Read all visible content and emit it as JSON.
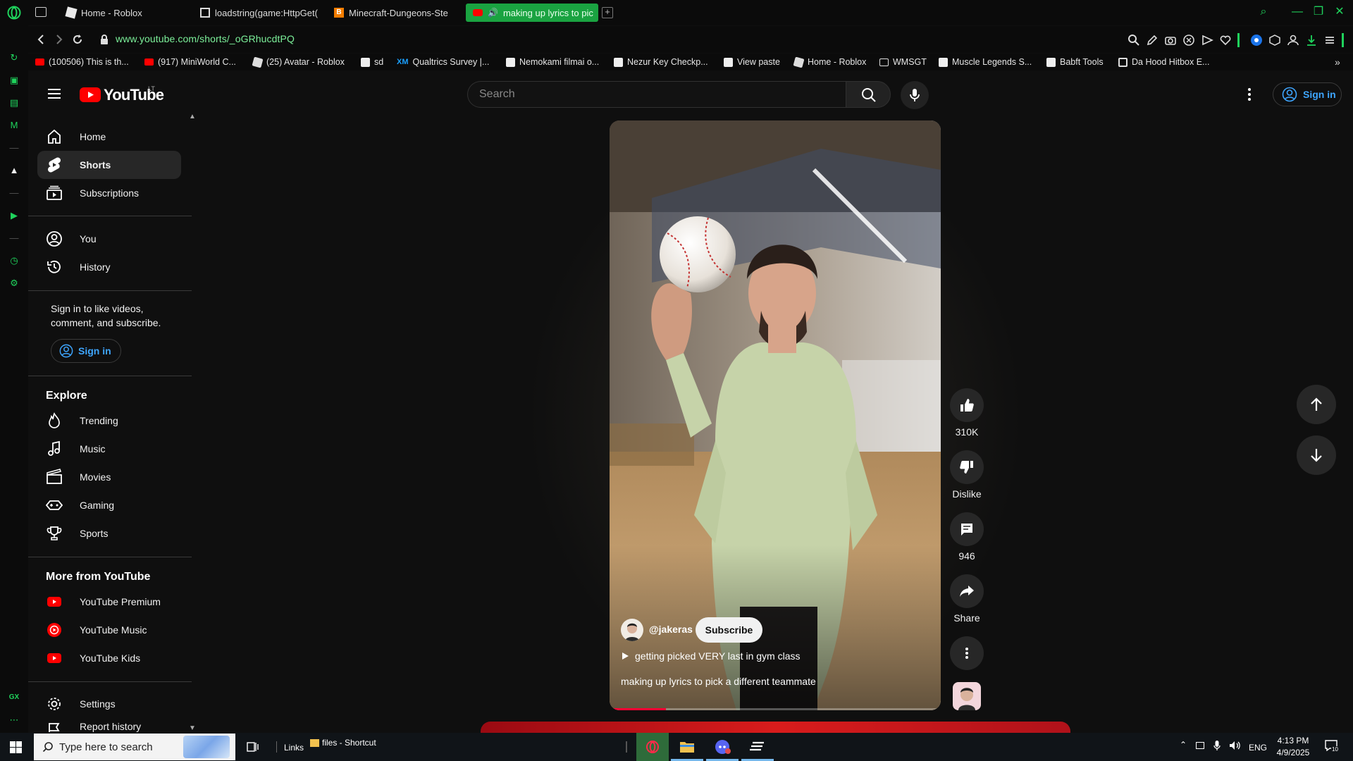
{
  "browser": {
    "tabs": [
      {
        "title": "Home - Roblox",
        "active": false
      },
      {
        "title": "loadstring(game:HttpGet(",
        "active": false
      },
      {
        "title": "Minecraft-Dungeons-Ste",
        "active": false
      },
      {
        "title": "making up lyrics to pic",
        "active": true
      }
    ],
    "url": "www.youtube.com/shorts/_oGRhucdtPQ",
    "bookmarks": [
      "(100506) This is th...",
      "(917) MiniWorld C...",
      "(25) Avatar - Roblox",
      "sd",
      "Qualtrics Survey |...",
      "Nemokami filmai o...",
      "Nezur Key Checkp...",
      "View paste",
      "Home - Roblox",
      "WMSGT",
      "Muscle Legends S...",
      "Babft Tools",
      "Da Hood Hitbox E..."
    ],
    "bookmark_xm_prefix": "XM",
    "accent": "#1fd35c",
    "sidebar_gx_label": "GX"
  },
  "youtube": {
    "logo_text": "YouTube",
    "country": "LT",
    "search_placeholder": "Search",
    "sign_in": "Sign in",
    "guide": {
      "main": [
        "Home",
        "Shorts",
        "Subscriptions"
      ],
      "you": [
        "You",
        "History"
      ],
      "signin_prompt": "Sign in to like videos, comment, and subscribe.",
      "signin_button": "Sign in",
      "explore_title": "Explore",
      "explore": [
        "Trending",
        "Music",
        "Movies",
        "Gaming",
        "Sports"
      ],
      "more_title": "More from YouTube",
      "more": [
        "YouTube Premium",
        "YouTube Music",
        "YouTube Kids"
      ],
      "settings": [
        "Settings",
        "Report history"
      ]
    },
    "short": {
      "channel": "@jakeras",
      "subscribe": "Subscribe",
      "playlist": "getting picked VERY last in gym class",
      "title": "making up lyrics to pick a different teammate",
      "progress": 0.17,
      "likes": "310K",
      "dislike": "Dislike",
      "comments": "946",
      "share": "Share"
    }
  },
  "taskbar": {
    "search_placeholder": "Type here to search",
    "links": "Links",
    "files_shortcut": "files - Shortcut",
    "language": "ENG",
    "time": "4:13 PM",
    "date": "4/9/2025",
    "notifications": "10"
  }
}
